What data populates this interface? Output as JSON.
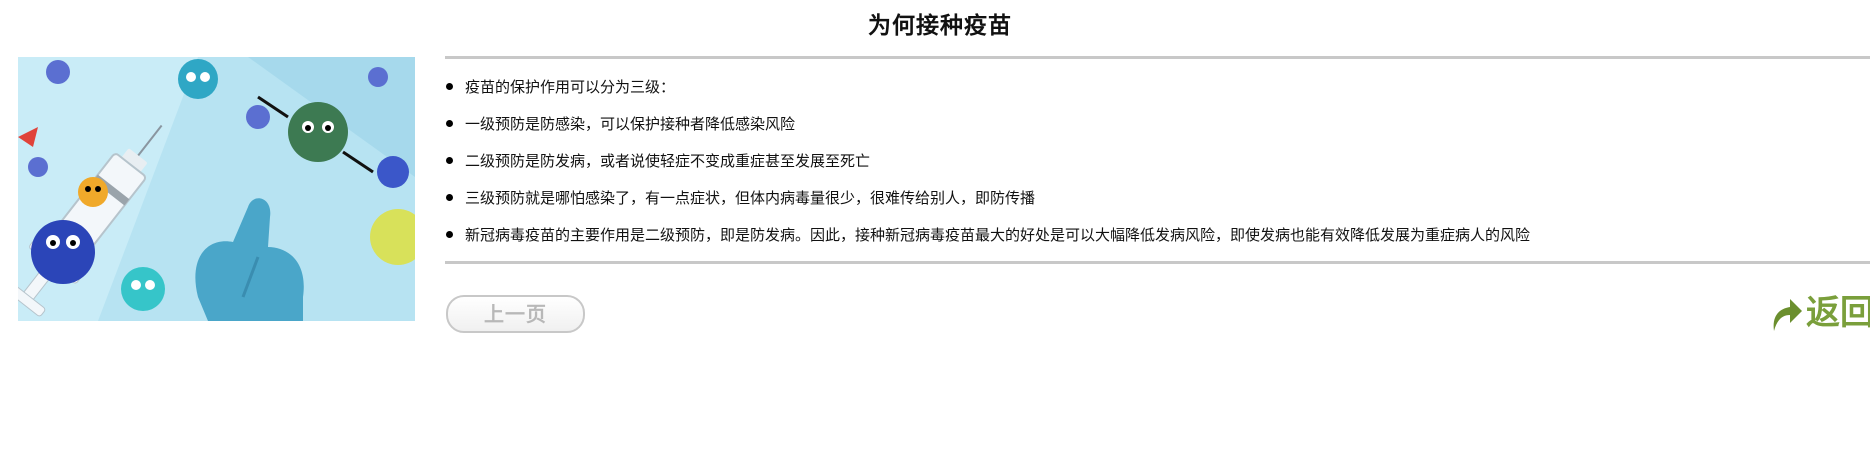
{
  "page": {
    "title": "为何接种疫苗"
  },
  "illustration": {
    "alt": "疫苗注射器与病毒卡通插图",
    "colors": {
      "background": "#b7e3f2",
      "glove": "#4aa6c9",
      "virus_green": "#3d7a52",
      "virus_blue": "#2b45b8",
      "virus_yellow": "#f0a92a",
      "virus_teal": "#36c5c9"
    }
  },
  "content": {
    "items": [
      {
        "icon": "bullet-icon",
        "text": "疫苗的保护作用可以分为三级："
      },
      {
        "icon": "bullet-icon",
        "text": "一级预防是防感染，可以保护接种者降低感染风险"
      },
      {
        "icon": "bullet-icon",
        "text": "二级预防是防发病，或者说使轻症不变成重症甚至发展至死亡"
      },
      {
        "icon": "bullet-icon",
        "text": "三级预防就是哪怕感染了，有一点症状，但体内病毒量很少，很难传给别人，即防传播"
      },
      {
        "icon": "bullet-icon",
        "text": "新冠病毒疫苗的主要作用是二级预防，即是防发病。因此，接种新冠病毒疫苗最大的好处是可以大幅降低发病风险，即使发病也能有效降低发展为重症病人的风险"
      }
    ]
  },
  "navigation": {
    "prev_label": "上一页",
    "back_label": "返回",
    "back_icon": "return-arrow-icon",
    "colors": {
      "back": "#7a9f3b",
      "prev_text": "#b8b8b8",
      "prev_border": "#c8c8c8"
    }
  }
}
